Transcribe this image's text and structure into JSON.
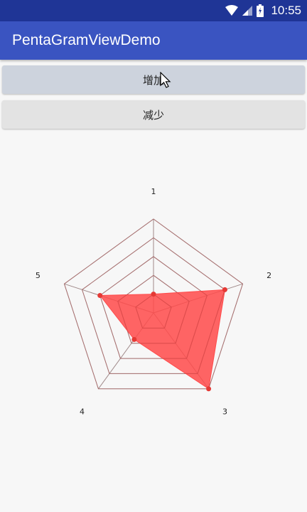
{
  "status_bar": {
    "time": "10:55",
    "icons": [
      "wifi-icon",
      "signal-icon",
      "battery-icon"
    ]
  },
  "app_bar": {
    "title": "PentaGramViewDemo",
    "color": "#3a54c1"
  },
  "buttons": {
    "add_label": "增加",
    "subtract_label": "减少"
  },
  "chart_data": {
    "type": "radar",
    "axes": [
      "1",
      "2",
      "3",
      "4",
      "5"
    ],
    "values": [
      0.2,
      0.8,
      1.0,
      0.35,
      0.6
    ],
    "max": 1,
    "levels": 5,
    "fill_color": "#ff4a4a",
    "point_color": "#e53935",
    "grid_color": "#a08a8a"
  }
}
